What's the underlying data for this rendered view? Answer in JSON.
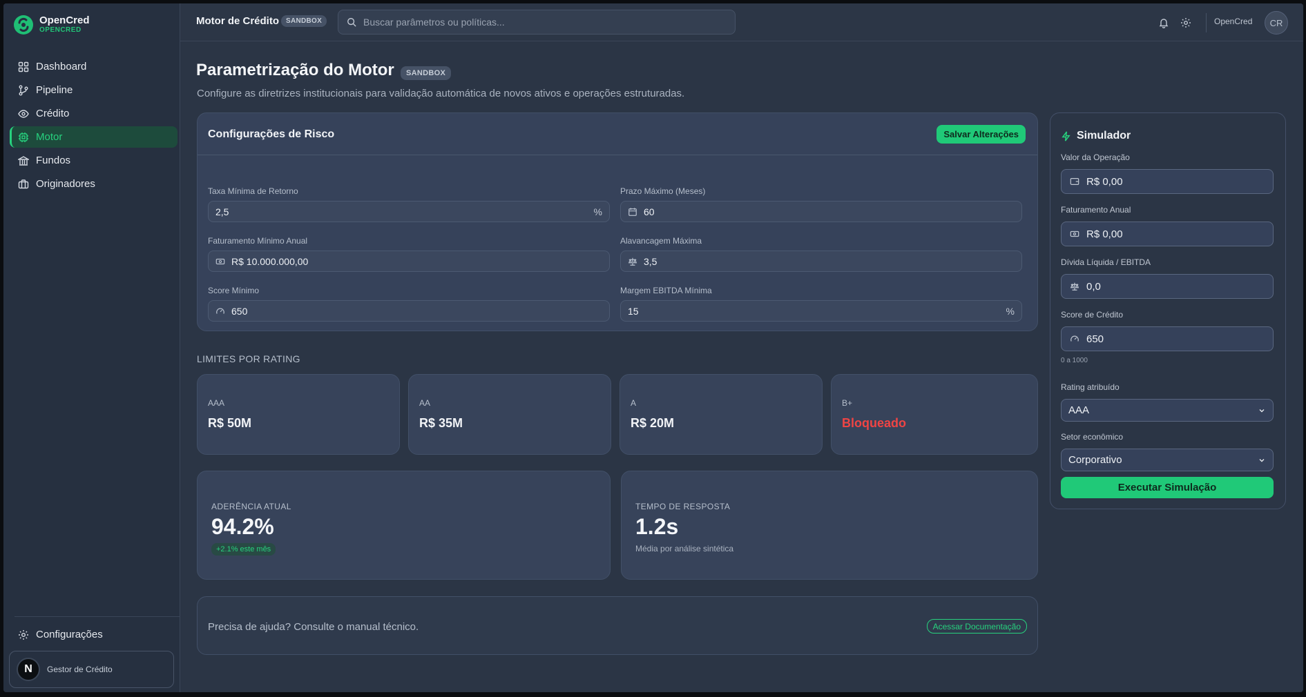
{
  "brand": {
    "name": "OpenCred",
    "subtitle": "OPENCRED",
    "accent": "#22c578"
  },
  "sidebar": {
    "items": [
      {
        "label": "Dashboard",
        "icon": "grid-icon"
      },
      {
        "label": "Pipeline",
        "icon": "git-branch-icon"
      },
      {
        "label": "Crédito",
        "icon": "eye-icon"
      },
      {
        "label": "Motor",
        "icon": "cpu-icon",
        "active": true
      },
      {
        "label": "Fundos",
        "icon": "bank-icon"
      },
      {
        "label": "Originadores",
        "icon": "briefcase-icon"
      }
    ],
    "settings_label": "Configurações",
    "user": {
      "avatar_letter": "N",
      "name": "Gestor de Crédito"
    }
  },
  "header": {
    "title": "Motor de Crédito",
    "badge": "SANDBOX",
    "search_placeholder": "Buscar parâmetros ou políticas...",
    "user_name": "OpenCred",
    "user_initials": "CR"
  },
  "page": {
    "title": "Parametrização do Motor",
    "badge": "SANDBOX",
    "subtitle": "Configure as diretrizes institucionais para validação automática de novos ativos e operações estruturadas."
  },
  "risk": {
    "title": "Configurações de Risco",
    "save_label": "Salvar Alterações",
    "fields": {
      "min_return": {
        "label": "Taxa Mínima de Retorno",
        "value": "2,5",
        "suffix": "%"
      },
      "max_term": {
        "label": "Prazo Máximo (Meses)",
        "value": "60"
      },
      "min_revenue": {
        "label": "Faturamento Mínimo Anual",
        "value": "R$ 10.000.000,00"
      },
      "max_leverage": {
        "label": "Alavancagem Máxima",
        "value": "3,5"
      },
      "min_score": {
        "label": "Score Mínimo",
        "value": "650"
      },
      "min_ebitda_margin": {
        "label": "Margem EBITDA Mínima",
        "value": "15",
        "suffix": "%"
      }
    }
  },
  "limits": {
    "section_label": "LIMITES POR RATING",
    "ratings": [
      {
        "name": "AAA",
        "value": "R$ 50M"
      },
      {
        "name": "AA",
        "value": "R$ 35M"
      },
      {
        "name": "A",
        "value": "R$ 20M"
      },
      {
        "name": "B+",
        "value": "Bloqueado",
        "status_color": "#ef4444"
      }
    ]
  },
  "metrics": {
    "adherence": {
      "label": "ADERÊNCIA ATUAL",
      "value": "94.2%",
      "change": "+2.1% este mês"
    },
    "response": {
      "label": "TEMPO DE RESPOSTA",
      "value": "1.2s",
      "note": "Média por análise sintética"
    }
  },
  "help": {
    "text": "Precisa de ajuda? Consulte o manual técnico.",
    "button_label": "Acessar Documentação"
  },
  "simulator": {
    "title": "Simulador",
    "fields": {
      "operation_value": {
        "label": "Valor da Operação",
        "value": "R$ 0,00"
      },
      "annual_revenue": {
        "label": "Faturamento Anual",
        "value": "R$ 0,00"
      },
      "net_debt_ebitda": {
        "label": "Dívida Líquida / EBITDA",
        "value": "0,0"
      },
      "credit_score": {
        "label": "Score de Crédito",
        "value": "650",
        "hint": "0 a 1000"
      },
      "rating": {
        "label": "Rating atribuído",
        "value": "AAA"
      },
      "sector": {
        "label": "Setor econômico",
        "value": "Corporativo"
      }
    },
    "run_label": "Executar Simulação"
  }
}
